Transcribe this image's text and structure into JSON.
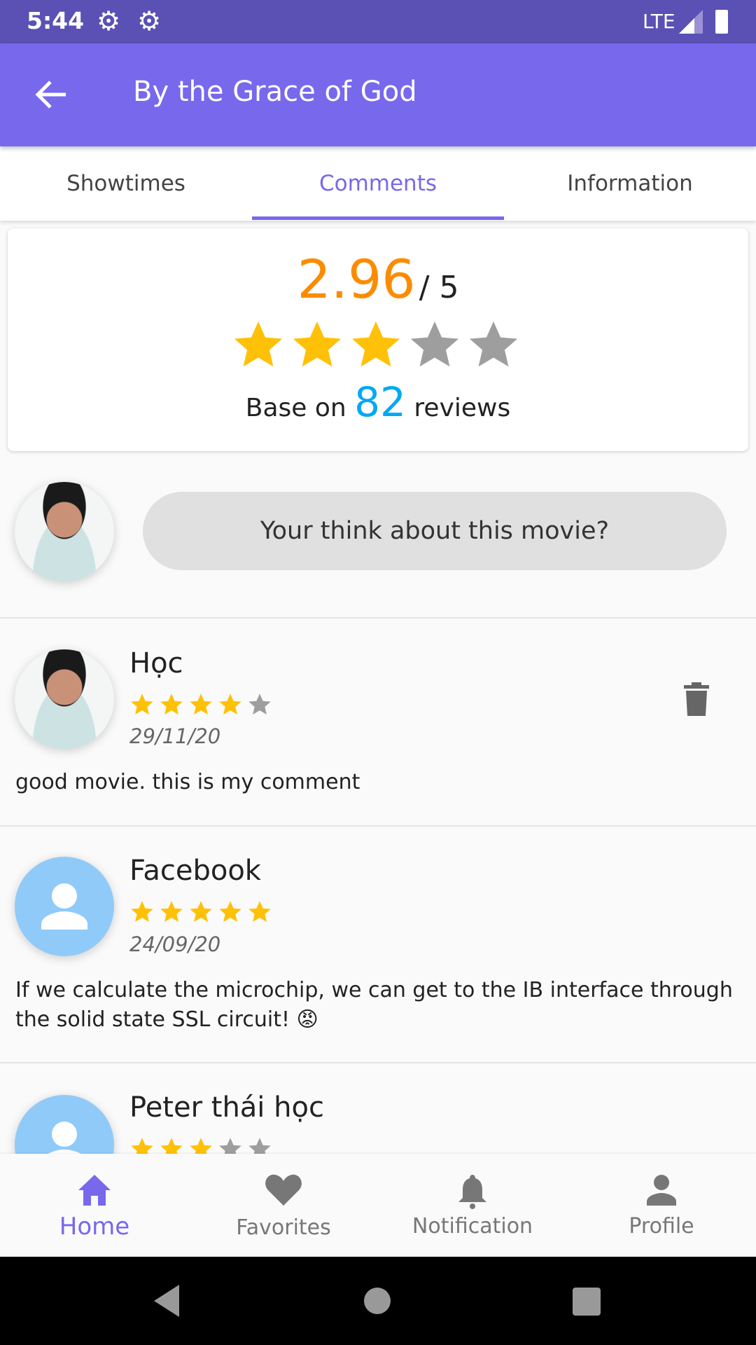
{
  "status_bar": {
    "time": "5:44",
    "network": "LTE"
  },
  "app_bar": {
    "title": "By the Grace of God"
  },
  "tabs": [
    {
      "label": "Showtimes"
    },
    {
      "label": "Comments",
      "active": true
    },
    {
      "label": "Information"
    }
  ],
  "rating": {
    "score": "2.96",
    "out_of": "/ 5",
    "stars_filled": 3,
    "stars_total": 5,
    "prefix": "Base on",
    "count": "82",
    "suffix": "reviews"
  },
  "comment_input": {
    "placeholder": "Your think about this movie?"
  },
  "comments": [
    {
      "name": "Học",
      "stars": 4,
      "date": "29/11/20",
      "text": "good movie. this is my comment",
      "deletable": true
    },
    {
      "name": "Facebook",
      "stars": 5,
      "date": "24/09/20",
      "text": "If we calculate the microchip, we can get to the IB interface through the solid state SSL circuit! 😡"
    },
    {
      "name": "Peter thái học",
      "stars": 3
    }
  ],
  "bottom_nav": [
    {
      "label": "Home",
      "icon": "home-icon",
      "active": true
    },
    {
      "label": "Favorites",
      "icon": "heart-icon"
    },
    {
      "label": "Notification",
      "icon": "bell-icon"
    },
    {
      "label": "Profile",
      "icon": "person-icon"
    }
  ],
  "colors": {
    "primary": "#7868ec",
    "status": "#5b50b4",
    "score": "#fb8c00",
    "count": "#03a9f4",
    "star_on": "#ffc107",
    "star_off": "#9e9e9e"
  }
}
